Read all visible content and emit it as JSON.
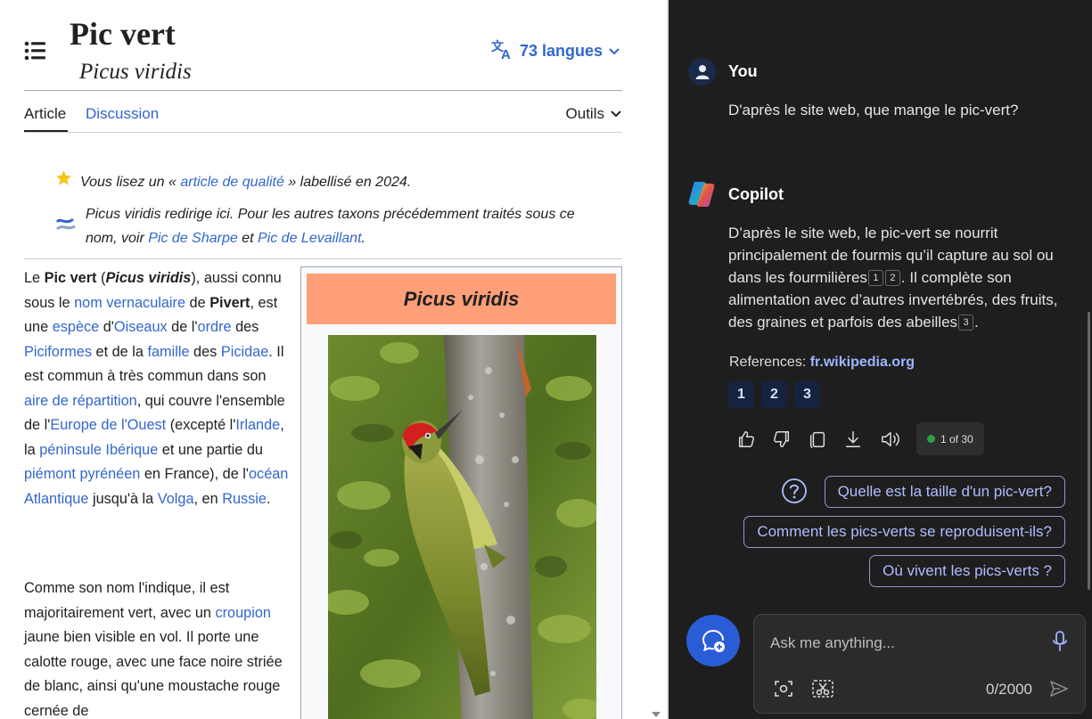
{
  "wiki": {
    "title": "Pic vert",
    "subtitle": "Picus viridis",
    "languages_label": "73 langues",
    "tabs": {
      "article": "Article",
      "discussion": "Discussion",
      "tools": "Outils"
    },
    "quality_notice": {
      "before": "Vous lisez un « ",
      "link": "article de qualité",
      "after": " » labellisé en 2024."
    },
    "redirect_notice": {
      "text1": "Picus viridis redirige ici. Pour les autres taxons précédemment traités sous ce nom, voir ",
      "link1": "Pic de Sharpe",
      "text2": " et ",
      "link2": "Pic de Levaillant",
      "text3": "."
    },
    "infobox_title": "Picus viridis",
    "para1": [
      {
        "t": "Le "
      },
      {
        "b": "Pic vert"
      },
      {
        "t": " ("
      },
      {
        "bi": "Picus viridis"
      },
      {
        "t": "), aussi connu sous le "
      },
      {
        "a": "nom vernaculaire"
      },
      {
        "t": " de "
      },
      {
        "b": "Pivert"
      },
      {
        "t": ", est une "
      },
      {
        "a": "espèce"
      },
      {
        "t": " d'"
      },
      {
        "a": "Oiseaux"
      },
      {
        "t": " de l'"
      },
      {
        "a": "ordre"
      },
      {
        "t": " des "
      },
      {
        "a": "Piciformes"
      },
      {
        "t": " et de la "
      },
      {
        "a": "famille"
      },
      {
        "t": " des "
      },
      {
        "a": "Picidae"
      },
      {
        "t": ". Il est commun à très commun dans son "
      },
      {
        "a": "aire de répartition"
      },
      {
        "t": ", qui couvre l'ensemble de l'"
      },
      {
        "a": "Europe de l'Ouest"
      },
      {
        "t": " (excepté l'"
      },
      {
        "a": "Irlande"
      },
      {
        "t": ", la "
      },
      {
        "a": "péninsule Ibérique"
      },
      {
        "t": " et une partie du "
      },
      {
        "a": "piémont pyrénéen"
      },
      {
        "t": " en France), de l'"
      },
      {
        "a": "océan Atlantique"
      },
      {
        "t": " jusqu'à la "
      },
      {
        "a": "Volga"
      },
      {
        "t": ", en "
      },
      {
        "a": "Russie"
      },
      {
        "t": "."
      }
    ],
    "para2": [
      {
        "t": "Comme son nom l'indique, il est majoritairement vert, avec un "
      },
      {
        "a": "croupion"
      },
      {
        "t": " jaune bien visible en vol. Il porte une calotte rouge, avec une face noire striée de blanc, ainsi qu'une moustache rouge cernée de"
      }
    ]
  },
  "copilot": {
    "user_name": "You",
    "user_message": "D'après le site web, que mange le pic-vert?",
    "assistant_name": "Copilot",
    "answer": [
      {
        "t": "D’après le site web, le pic-vert se nourrit principalement de fourmis qu’il capture au sol ou dans les fourmilières"
      },
      {
        "c": "1"
      },
      {
        "c": "2"
      },
      {
        "t": ". Il complète son alimentation avec d’autres invertébrés, des fruits, des graines et parfois des abeilles"
      },
      {
        "c": "3"
      },
      {
        "t": "."
      }
    ],
    "references_label": "References:",
    "references_domain": "fr.wikipedia.org",
    "reference_buttons": [
      "1",
      "2",
      "3"
    ],
    "response_count": "1 of 30",
    "suggestions": [
      "Quelle est la taille d'un pic-vert?",
      "Comment les pics-verts se reproduisent-ils?",
      "Où vivent les pics-verts ?"
    ],
    "input_placeholder": "Ask me anything...",
    "char_count": "0/2000"
  },
  "colors": {
    "link": "#3366cc",
    "infobox_header": "#fe9f78",
    "copilot_bg": "#1e1e1e",
    "accent_blue": "#2a5cd6",
    "suggestion_text": "#aebdff"
  }
}
